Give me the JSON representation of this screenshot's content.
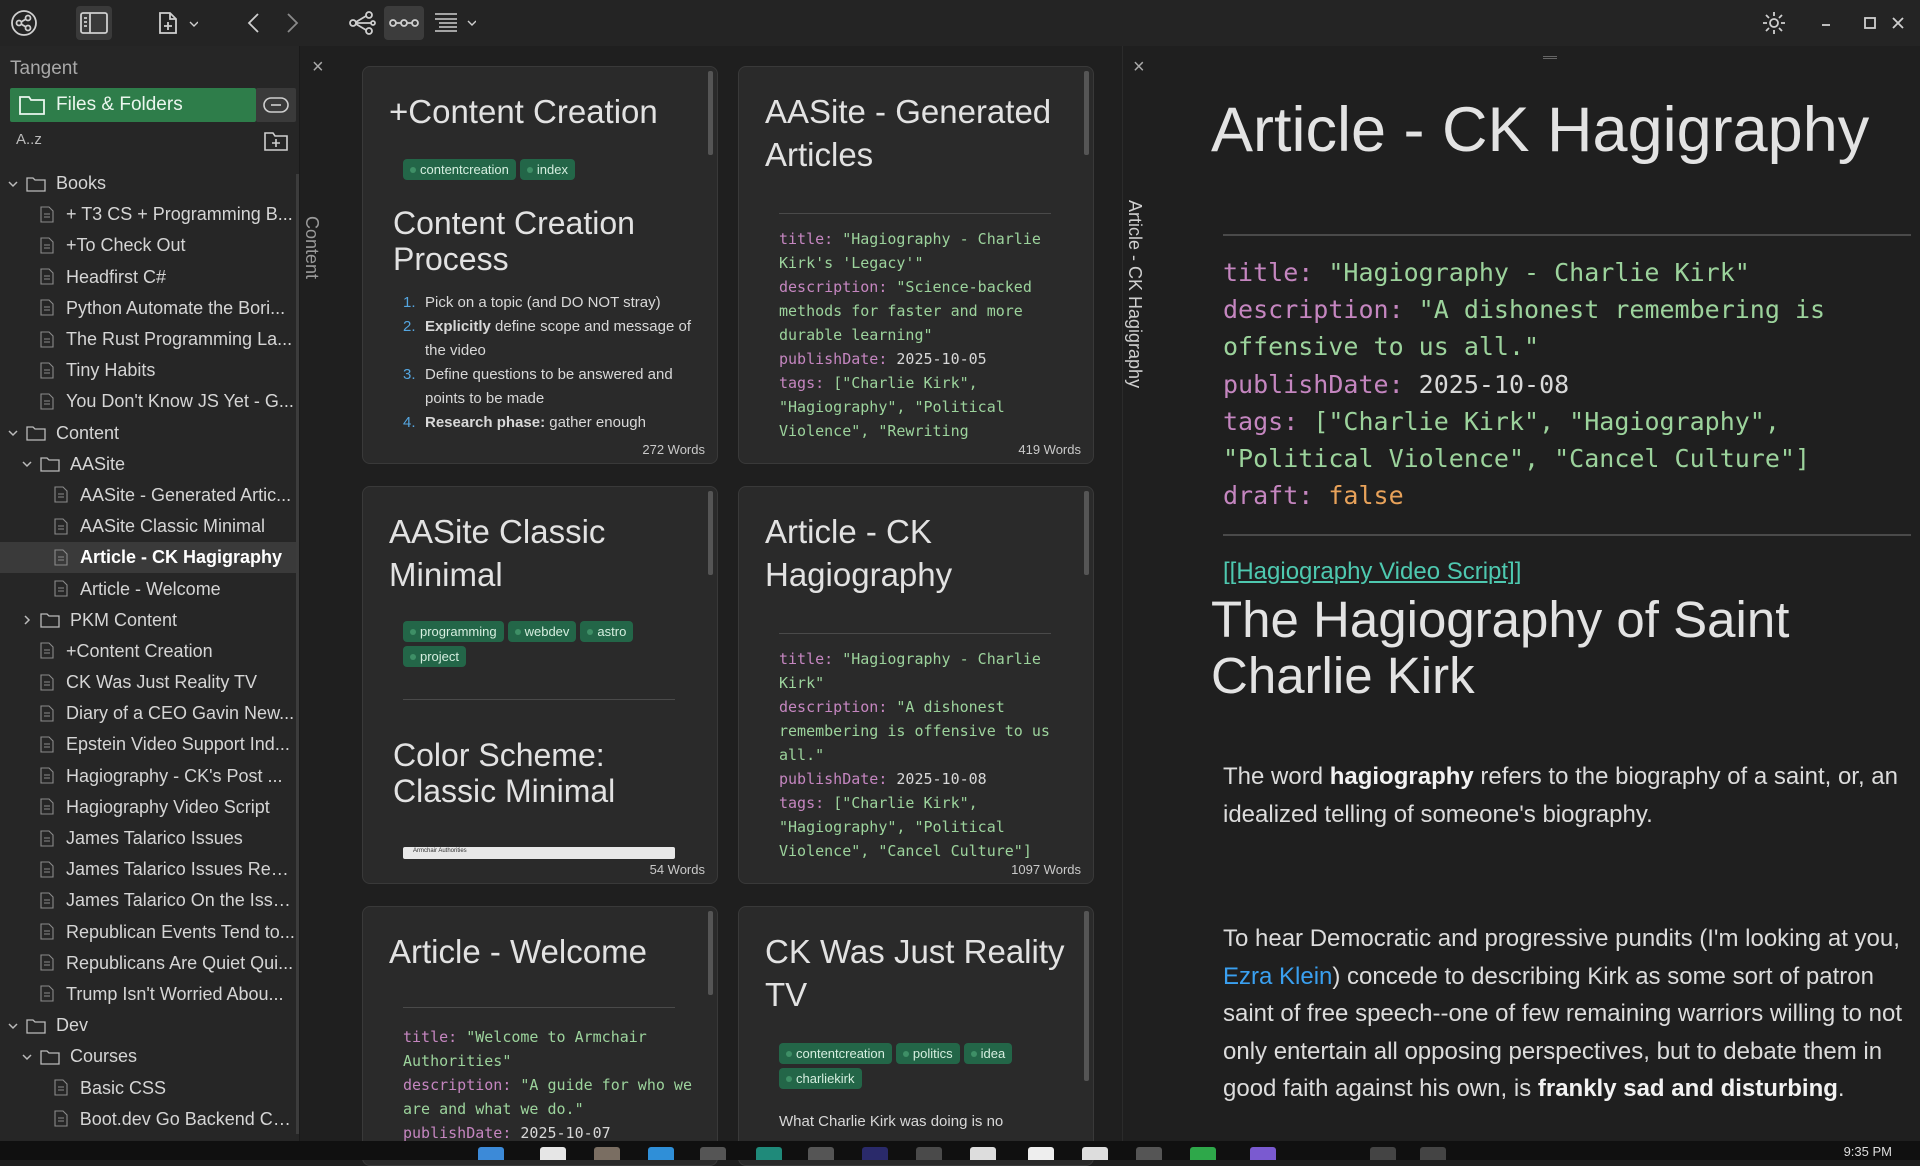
{
  "colors": {
    "accent": "#2e7d4a",
    "tag_bg": "#236648",
    "code_key": "#c586c0",
    "code_str": "#9cd39c",
    "link": "#3aa0f0",
    "wikilink": "#4ec9b0"
  },
  "topbar": {
    "icons": [
      "graph-icon",
      "sidebar-toggle-icon",
      "new-note-icon",
      "back-icon",
      "forward-icon",
      "link-graph-icon",
      "dots-view-icon",
      "list-view-icon",
      "settings-icon",
      "minimize-icon",
      "maximize-icon",
      "close-icon"
    ]
  },
  "sidebar": {
    "title": "Tangent",
    "files_tab_label": "Files & Folders",
    "sort_label": "A..z",
    "tree": [
      {
        "label": "Books",
        "kind": "folder",
        "depth": 0,
        "open": true
      },
      {
        "label": "+ T3 CS + Programming B...",
        "kind": "file",
        "depth": 1
      },
      {
        "label": "+To Check Out",
        "kind": "file",
        "depth": 1
      },
      {
        "label": "Headfirst C#",
        "kind": "file",
        "depth": 1
      },
      {
        "label": "Python Automate the Bori...",
        "kind": "file",
        "depth": 1
      },
      {
        "label": "The Rust Programming La...",
        "kind": "file",
        "depth": 1
      },
      {
        "label": "Tiny Habits",
        "kind": "file",
        "depth": 1
      },
      {
        "label": "You Don't Know JS Yet - G...",
        "kind": "file",
        "depth": 1
      },
      {
        "label": "Content",
        "kind": "folder",
        "depth": 0,
        "open": true
      },
      {
        "label": "AASite",
        "kind": "folder",
        "depth": 1,
        "open": true
      },
      {
        "label": "AASite - Generated Artic...",
        "kind": "file",
        "depth": 2
      },
      {
        "label": "AASite Classic Minimal",
        "kind": "file",
        "depth": 2
      },
      {
        "label": "Article - CK Hagigraphy",
        "kind": "file",
        "depth": 2,
        "selected": true
      },
      {
        "label": "Article - Welcome",
        "kind": "file",
        "depth": 2
      },
      {
        "label": "PKM Content",
        "kind": "folder",
        "depth": 1,
        "open": false
      },
      {
        "label": "+Content Creation",
        "kind": "file",
        "depth": 1
      },
      {
        "label": "CK Was Just Reality TV",
        "kind": "file",
        "depth": 1
      },
      {
        "label": "Diary of a CEO Gavin New...",
        "kind": "file",
        "depth": 1
      },
      {
        "label": "Epstein Video Support Ind...",
        "kind": "file",
        "depth": 1
      },
      {
        "label": "Hagiography - CK's Post ...",
        "kind": "file",
        "depth": 1
      },
      {
        "label": "Hagiography Video Script",
        "kind": "file",
        "depth": 1
      },
      {
        "label": "James Talarico Issues",
        "kind": "file",
        "depth": 1
      },
      {
        "label": "James Talarico Issues Rewr...",
        "kind": "file",
        "depth": 1
      },
      {
        "label": "James Talarico On the Issu...",
        "kind": "file",
        "depth": 1
      },
      {
        "label": "Republican Events Tend to...",
        "kind": "file",
        "depth": 1
      },
      {
        "label": "Republicans Are Quiet Qui...",
        "kind": "file",
        "depth": 1
      },
      {
        "label": "Trump Isn't Worried Abou...",
        "kind": "file",
        "depth": 1
      },
      {
        "label": "Dev",
        "kind": "folder",
        "depth": 0,
        "open": true
      },
      {
        "label": "Courses",
        "kind": "folder",
        "depth": 1,
        "open": true
      },
      {
        "label": "Basic CSS",
        "kind": "file",
        "depth": 2
      },
      {
        "label": "Boot.dev Go Backend Co...",
        "kind": "file",
        "depth": 2
      }
    ]
  },
  "content_column": {
    "close_label": "×",
    "vertical_label": "Content",
    "cards": [
      {
        "title": "+Content Creation",
        "tags": [
          "contentcreation",
          "index"
        ],
        "heading": "Content Creation Process",
        "list": [
          {
            "n": "1.",
            "pre": "",
            "b": "",
            "t": "Pick on a topic (and DO NOT stray)"
          },
          {
            "n": "2.",
            "pre": "",
            "b": "Explicitly",
            "t": " define scope and message of the video"
          },
          {
            "n": "3.",
            "pre": "",
            "b": "",
            "t": "Define questions to be answered and points to be made"
          },
          {
            "n": "4.",
            "pre": "",
            "b": "Research phase:",
            "t": " gather enough"
          }
        ],
        "words": "272 Words"
      },
      {
        "title": "AASite - Generated Articles",
        "code": [
          [
            "title: ",
            "\"Hagiography - Charlie Kirk's 'Legacy'\""
          ],
          [
            "description: ",
            "\"Science-backed methods for faster and more durable learning\""
          ],
          [
            "publishDate: ",
            "2025-10-05"
          ],
          [
            "tags: ",
            "[\"Charlie Kirk\", \"Hagiography\", \"Political Violence\", \"Rewriting"
          ]
        ],
        "words": "419 Words"
      },
      {
        "title": "AASite Classic Minimal",
        "tags": [
          "programming",
          "webdev",
          "astro",
          "project"
        ],
        "heading": "Color Scheme: Classic Minimal",
        "preview_caption": "Armchair Authorities",
        "words": "54 Words"
      },
      {
        "title": "Article - CK Hagiography",
        "code": [
          [
            "title: ",
            "\"Hagiography - Charlie Kirk\""
          ],
          [
            "description: ",
            "\"A dishonest remembering is offensive to us all.\""
          ],
          [
            "publishDate: ",
            "2025-10-08"
          ],
          [
            "tags: ",
            "[\"Charlie Kirk\", \"Hagiography\", \"Political Violence\", \"Cancel Culture\"]"
          ]
        ],
        "words": "1097 Words"
      },
      {
        "title": "Article - Welcome",
        "code": [
          [
            "title: ",
            "\"Welcome to Armchair Authorities\""
          ],
          [
            "description: ",
            "\"A guide for who we are and what we do.\""
          ],
          [
            "publishDate: ",
            "2025-10-07"
          ]
        ]
      },
      {
        "title": "CK Was Just Reality TV",
        "tags": [
          "contentcreation",
          "politics",
          "idea",
          "charliekirk"
        ],
        "snippet": "What Charlie Kirk was doing is no"
      }
    ]
  },
  "reader": {
    "close_label": "×",
    "vertical_label": "Article - CK Hagigraphy",
    "title": "Article - CK Hagigraphy",
    "frontmatter": [
      [
        "title: ",
        "\"Hagiography - Charlie Kirk\""
      ],
      [
        "description: ",
        "\"A dishonest remembering is offensive to us all.\""
      ],
      [
        "publishDate: ",
        "2025-10-08"
      ],
      [
        "tags: ",
        "[\"Charlie Kirk\", \"Hagiography\", \"Political Violence\", \"Cancel Culture\"]"
      ],
      [
        "draft: ",
        "false"
      ]
    ],
    "wikilink": "[[Hagiography Video Script]]",
    "h1": "The Hagiography of Saint Charlie Kirk",
    "p1": {
      "a": "The word ",
      "b": "hagiography",
      "c": " refers to the biography of a saint, or, an idealized telling of someone's biography."
    },
    "p2": {
      "a": "To hear Democratic and progressive pundits (I'm looking at you, ",
      "link": "Ezra Klein",
      "c": ") concede to describing Kirk as some sort of patron saint of free speech--one of few remaining warriors willing to not only entertain all opposing perspectives, but to debate them in good faith against his own, is ",
      "b": "frankly sad and disturbing",
      "d": "."
    }
  },
  "taskbar": {
    "clock": "9:35 PM"
  }
}
